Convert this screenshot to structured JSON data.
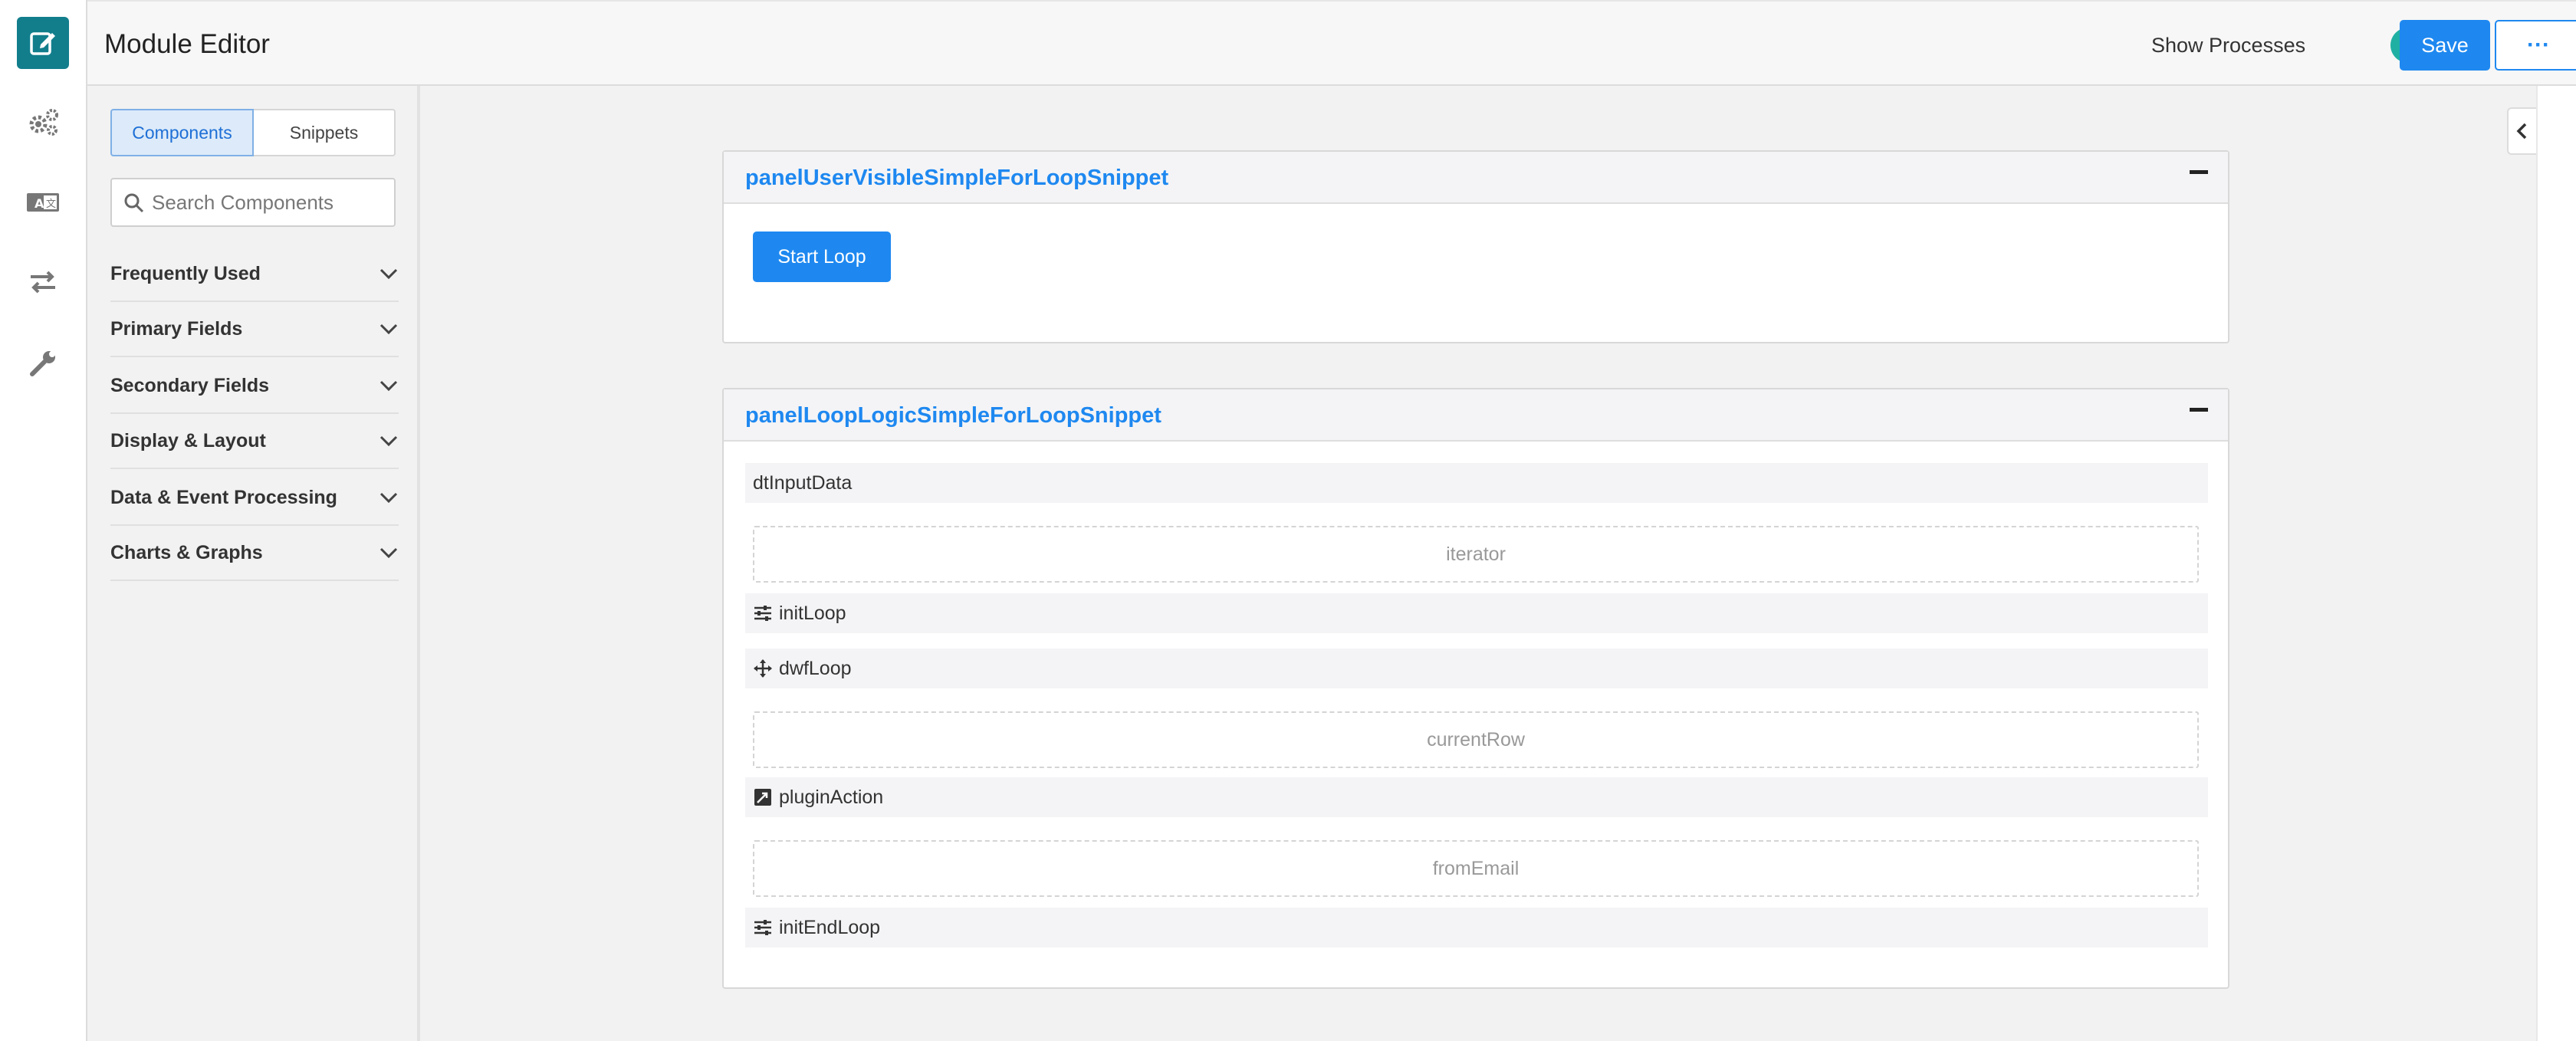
{
  "header": {
    "title": "Module Editor",
    "show_processes_label": "Show Processes",
    "show_processes_on": true,
    "save_label": "Save",
    "more_label": "···"
  },
  "rail": {
    "icons": [
      "edit-icon",
      "gears-icon",
      "language-icon",
      "exchange-icon",
      "wrench-icon"
    ]
  },
  "sidebar": {
    "tabs": [
      {
        "label": "Components",
        "active": true
      },
      {
        "label": "Snippets",
        "active": false
      }
    ],
    "search_placeholder": "Search Components",
    "categories": [
      {
        "label": "Frequently Used"
      },
      {
        "label": "Primary Fields"
      },
      {
        "label": "Secondary Fields"
      },
      {
        "label": "Display & Layout"
      },
      {
        "label": "Data & Event Processing"
      },
      {
        "label": "Charts & Graphs"
      }
    ]
  },
  "panels": [
    {
      "title": "panelUserVisibleSimpleForLoopSnippet",
      "button_label": "Start Loop"
    },
    {
      "title": "panelLoopLogicSimpleForLoopSnippet",
      "items": [
        {
          "kind": "row",
          "label": "dtInputData",
          "icon": ""
        },
        {
          "kind": "drop",
          "label": "iterator"
        },
        {
          "kind": "row",
          "label": "initLoop",
          "icon": "sliders-icon"
        },
        {
          "kind": "row",
          "label": "dwfLoop",
          "icon": "move-icon"
        },
        {
          "kind": "drop",
          "label": "currentRow"
        },
        {
          "kind": "row",
          "label": "pluginAction",
          "icon": "plugin-icon"
        },
        {
          "kind": "drop",
          "label": "fromEmail"
        },
        {
          "kind": "row",
          "label": "initEndLoop",
          "icon": "sliders-icon"
        }
      ]
    }
  ],
  "colors": {
    "accent": "#1e88f0",
    "logo_bg": "#127e8c",
    "toggle_on": "#20b0a3"
  }
}
